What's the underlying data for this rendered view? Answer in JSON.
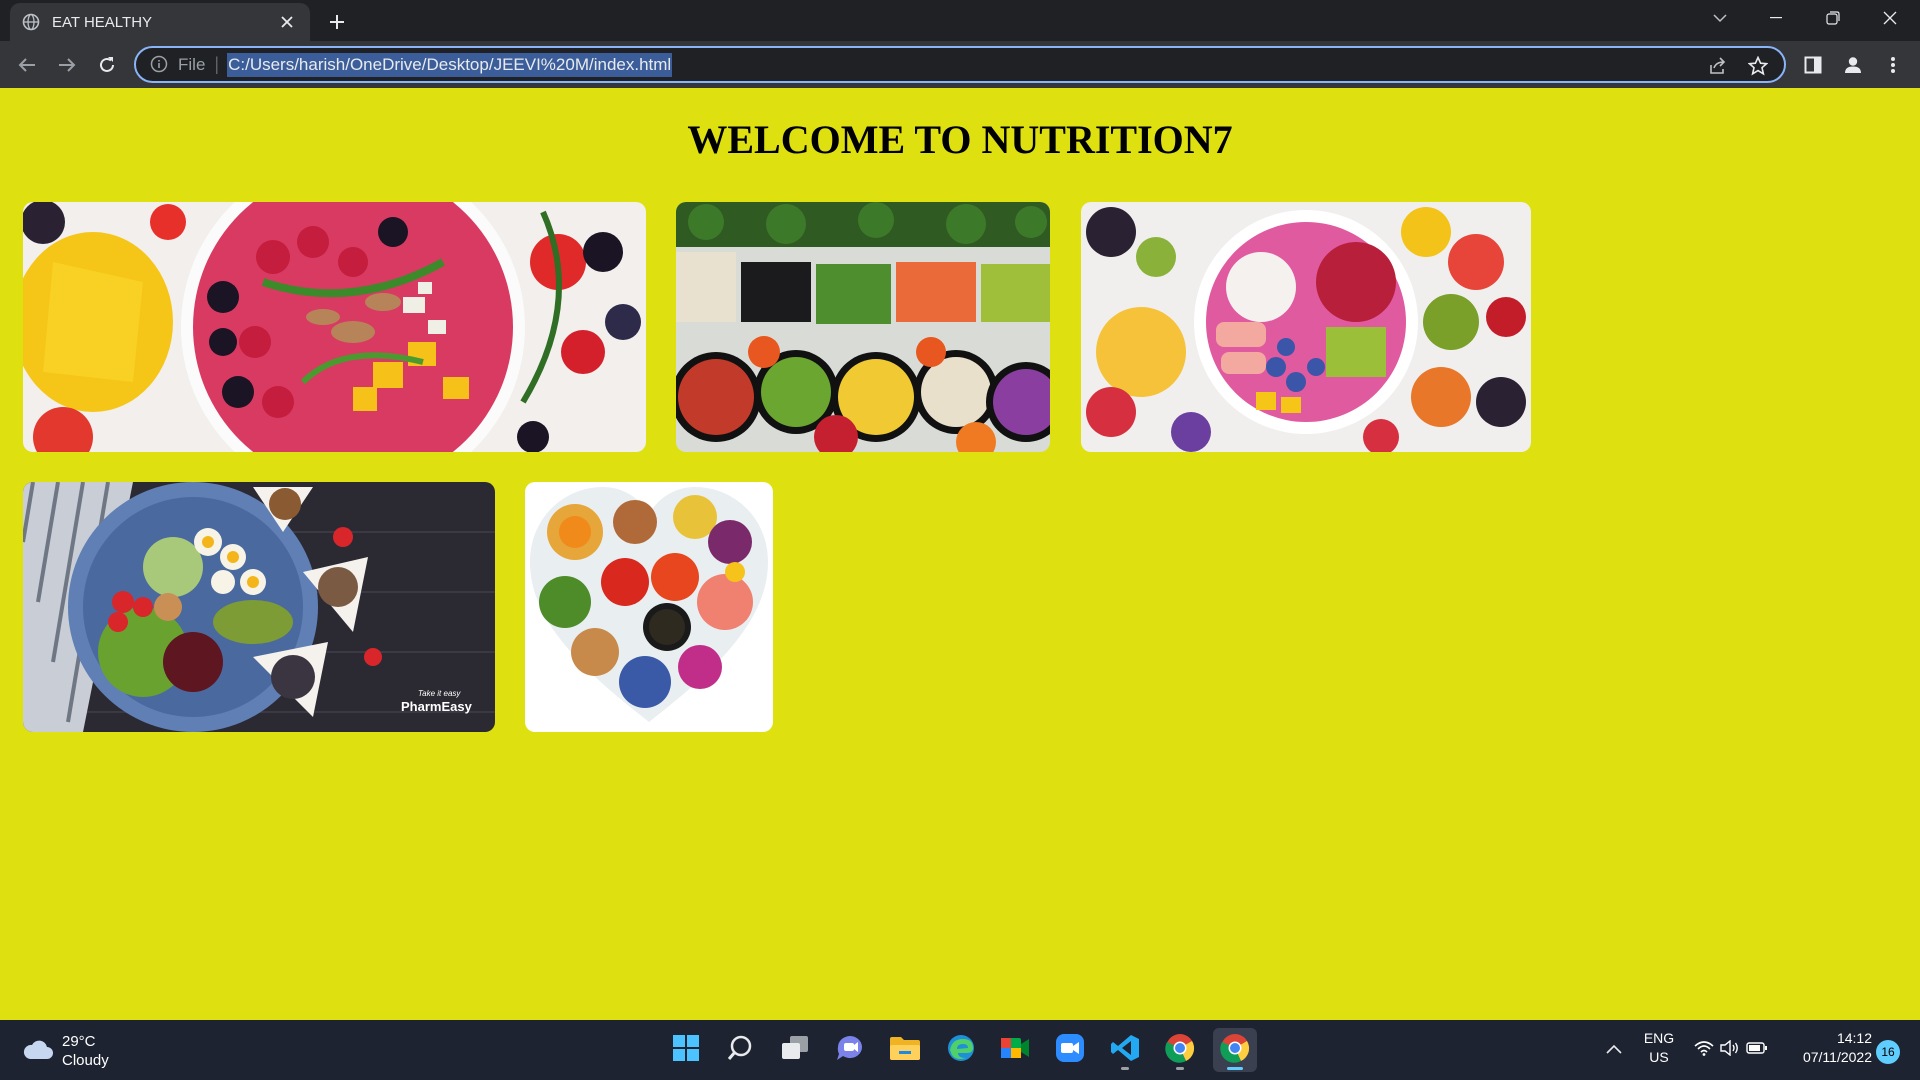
{
  "browser": {
    "tab": {
      "title": "EAT HEALTHY",
      "favicon": "globe-icon"
    },
    "address": {
      "scheme": "File",
      "url": "C:/Users/harish/OneDrive/Desktop/JEEVI%20M/index.html"
    }
  },
  "page": {
    "heading": "WELCOME TO NUTRITION7",
    "background": "#dfe010",
    "images": [
      {
        "name": "smoothie-bowl-berries-image"
      },
      {
        "name": "vegetable-buffet-image"
      },
      {
        "name": "fruit-bowl-image"
      },
      {
        "name": "pharmeasy-salad-image",
        "watermark": "Take it easy",
        "brand": "PharmEasy"
      },
      {
        "name": "heart-shaped-food-image"
      }
    ]
  },
  "taskbar": {
    "weather": {
      "temp": "29°C",
      "condition": "Cloudy"
    },
    "apps": [
      "start-icon",
      "search-icon",
      "task-view-icon",
      "chat-icon",
      "file-explorer-icon",
      "edge-icon",
      "meet-icon",
      "zoom-icon",
      "vscode-icon",
      "chrome-icon",
      "chrome-active-icon"
    ],
    "tray": {
      "language": "ENG",
      "region": "US",
      "time": "14:12",
      "date": "07/11/2022",
      "notifications": "16"
    }
  }
}
